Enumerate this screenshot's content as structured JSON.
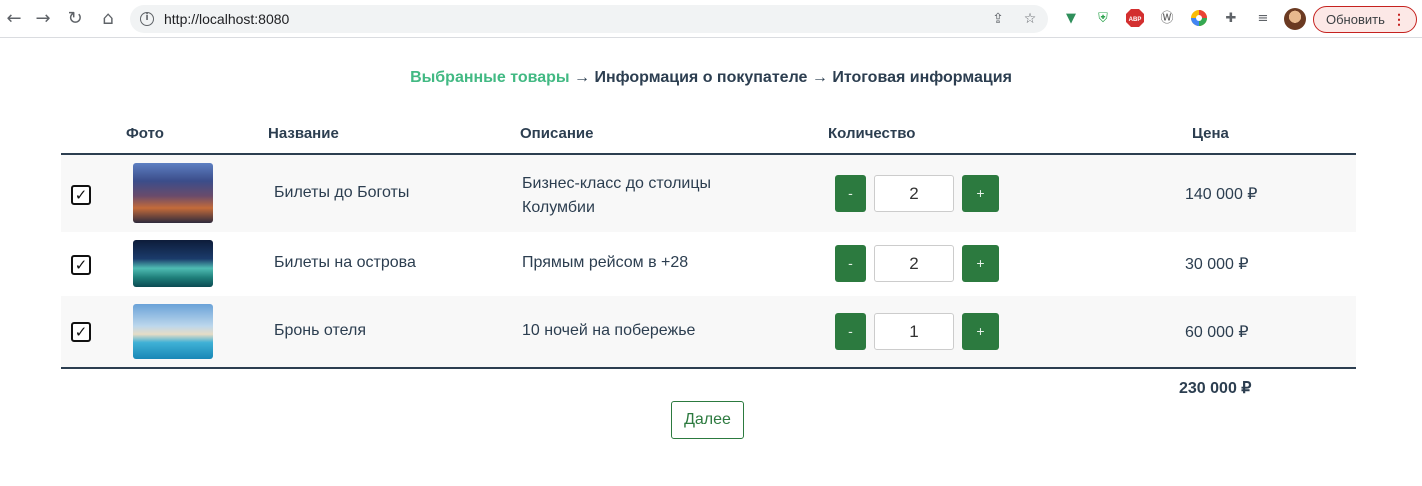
{
  "browser": {
    "url": "http://localhost:8080",
    "update_label": "Обновить",
    "update_dots": "⋮",
    "icons": [
      "back-icon",
      "forward-icon",
      "reload-icon",
      "home-icon",
      "info-icon",
      "share-icon",
      "star-icon",
      "vue-devtools-icon",
      "shield-icon",
      "adblock-icon",
      "wordpress-icon",
      "color-wheel-icon",
      "puzzle-icon",
      "reading-list-icon",
      "avatar"
    ]
  },
  "steps": {
    "step1": "Выбранные товары",
    "arrow1": " → ",
    "step2": "Информация о покупателе",
    "arrow2": " → ",
    "step3": "Итоговая информация"
  },
  "table": {
    "headers": {
      "photo": "Фото",
      "name": "Название",
      "description": "Описание",
      "quantity": "Количество",
      "price": "Цена"
    },
    "rows": [
      {
        "checked": "✓",
        "name": "Билеты до Боготы",
        "description_line1": "Бизнес-класс до столицы",
        "description_line2": "Колумбии",
        "minus": "-",
        "quantity": "2",
        "plus": "+",
        "price": "140 000 ₽"
      },
      {
        "checked": "✓",
        "name": "Билеты на острова",
        "description_line1": "Прямым рейсом в +28",
        "description_line2": "",
        "minus": "-",
        "quantity": "2",
        "plus": "+",
        "price": "30 000 ₽"
      },
      {
        "checked": "✓",
        "name": "Бронь отеля",
        "description_line1": "10 ночей на побережье",
        "description_line2": "",
        "minus": "-",
        "quantity": "1",
        "plus": "+",
        "price": "60 000 ₽"
      }
    ],
    "total": "230 000 ₽"
  },
  "next_label": "Далее",
  "colors": {
    "accent_green": "#42b983",
    "button_green": "#2c7a3f",
    "text_dark": "#2c3e50",
    "update_red": "#c5221f"
  }
}
